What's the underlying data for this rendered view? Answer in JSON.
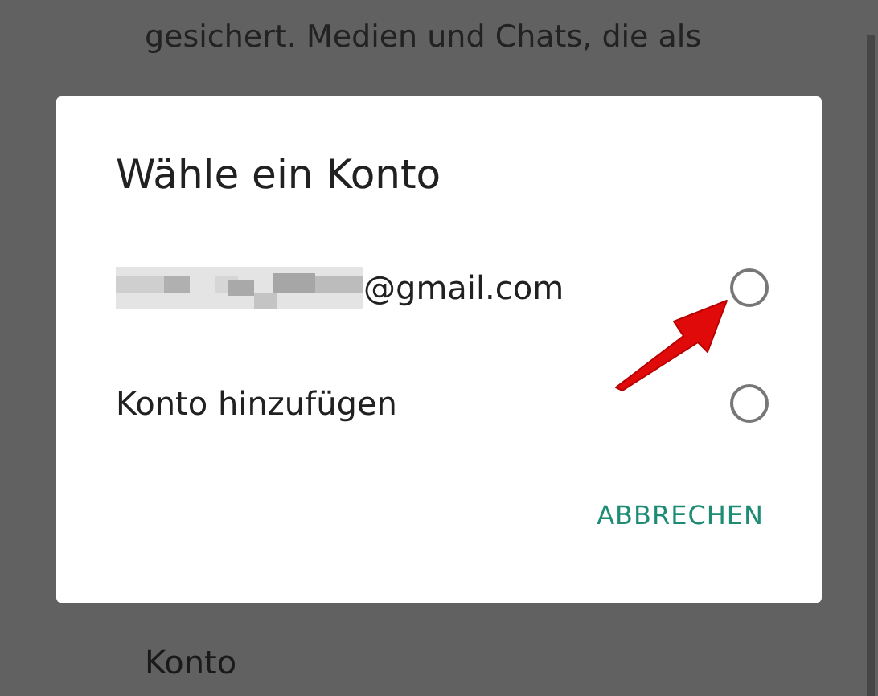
{
  "background": {
    "text_lines": [
      "gesichert. Medien und Chats, die als"
    ],
    "setting_title": "Konto"
  },
  "dialog": {
    "title": "Wähle ein Konto",
    "options": [
      {
        "kind": "account",
        "label": "@gmail.com",
        "selected": false
      },
      {
        "kind": "add",
        "label": "Konto hinzufügen",
        "selected": false
      }
    ],
    "buttons": [
      "ABBRECHEN"
    ]
  }
}
